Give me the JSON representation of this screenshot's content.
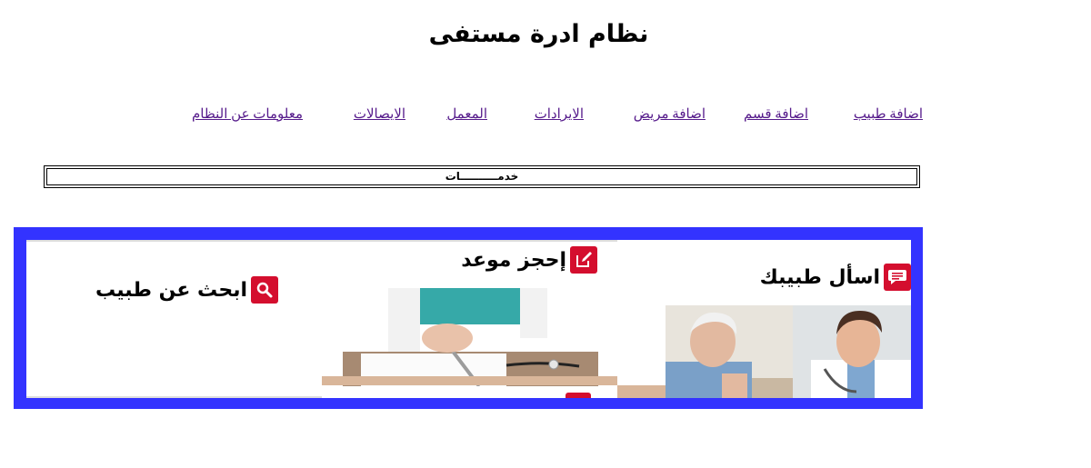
{
  "header": {
    "title": "نظام ادرة مستفى"
  },
  "nav": {
    "items": [
      {
        "label": "اضافة طبيب"
      },
      {
        "label": "اضافة قسم"
      },
      {
        "label": "اضافة مريض"
      },
      {
        "label": "الايرادات"
      },
      {
        "label": "المعمل"
      },
      {
        "label": "الايصالات"
      },
      {
        "label": "معلومات عن النظام"
      }
    ]
  },
  "services_bar": {
    "label": "خدمــــــــــات"
  },
  "services": {
    "ask": {
      "label": "اسأل طبيبك",
      "icon": "chat-icon"
    },
    "book": {
      "label": "إحجز موعد",
      "icon": "edit-icon"
    },
    "search": {
      "label": "ابحث عن طبيب",
      "icon": "search-icon"
    }
  },
  "colors": {
    "panel_border": "#3333ff",
    "icon_bg": "#d40e2e",
    "link": "#551a8b"
  }
}
